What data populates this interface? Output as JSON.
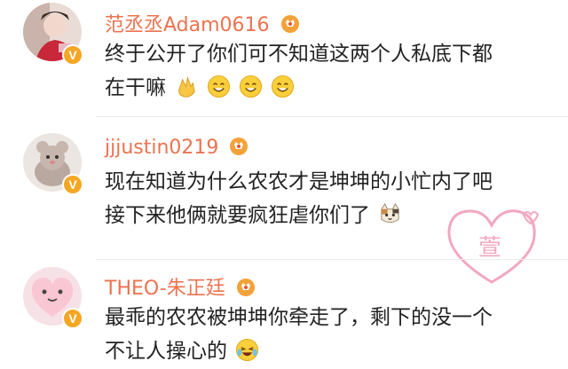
{
  "comments": [
    {
      "username": "范丞丞Adam0616",
      "line1": "终于公开了你们可不知道这两个人私底下都",
      "line2": "在干嘛",
      "badge": "V",
      "emojis": [
        "clap-emoji",
        "smile-emoji",
        "smile-emoji",
        "smile-emoji"
      ]
    },
    {
      "username": "jjjustin0219",
      "line1": "现在知道为什么农农才是坤坤的小忙内了吧",
      "line2": "接下来他俩就要疯狂虐你们了",
      "badge": "V",
      "emojis": [
        "cat-emoji"
      ]
    },
    {
      "username": "THEO-朱正廷",
      "line1": "最乖的农农被坤坤你牵走了，剩下的没一个",
      "line2": "不让人操心的",
      "badge": "V",
      "emojis": [
        "laugh-cry-emoji"
      ]
    }
  ],
  "watermark": {
    "text": "萱",
    "color": "#f2a7c0"
  },
  "colors": {
    "username": "#eb7350",
    "badge": "#f5a623",
    "text": "#222222"
  }
}
